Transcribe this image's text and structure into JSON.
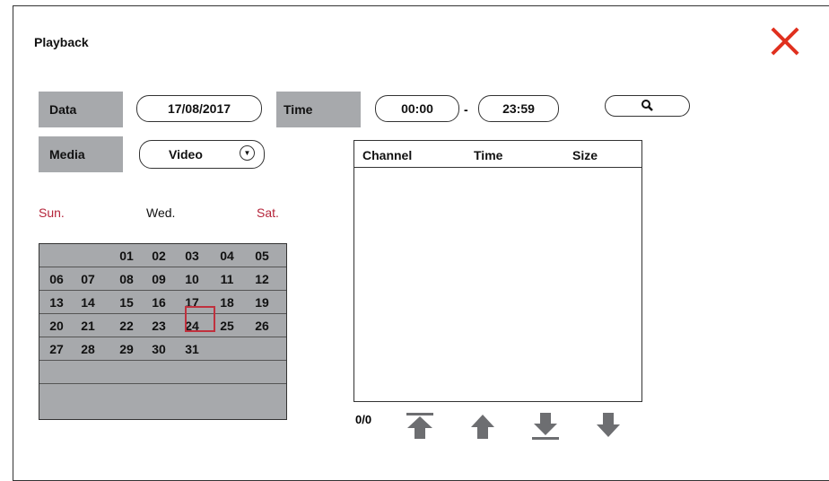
{
  "window": {
    "title": "Playback"
  },
  "filters": {
    "date_label": "Data",
    "date_value": "17/08/2017",
    "time_label": "Time",
    "time_start": "00:00",
    "time_separator": "-",
    "time_end": "23:59",
    "media_label": "Media",
    "media_value": "Video"
  },
  "calendar": {
    "day_headers": [
      "Sun.",
      "Wed.",
      "Sat."
    ],
    "selected_day": "17",
    "weeks": [
      [
        "",
        "",
        "01",
        "02",
        "03",
        "04",
        "05"
      ],
      [
        "06",
        "07",
        "08",
        "09",
        "10",
        "11",
        "12"
      ],
      [
        "13",
        "14",
        "15",
        "16",
        "17",
        "18",
        "19"
      ],
      [
        "20",
        "21",
        "22",
        "23",
        "24",
        "25",
        "26"
      ],
      [
        "27",
        "28",
        "29",
        "30",
        "31",
        "",
        ""
      ],
      [
        "",
        "",
        "",
        "",
        "",
        "",
        ""
      ]
    ]
  },
  "results": {
    "columns": [
      "Channel",
      "Time",
      "Size"
    ],
    "rows": [],
    "counter": "0/0"
  },
  "colors": {
    "accent_red": "#e0301e",
    "weekend_red": "#b5243a",
    "panel_gray": "#a7a9ac"
  },
  "icons": [
    "close-icon",
    "search-icon",
    "dropdown-arrow-icon",
    "first-page-icon",
    "previous-page-icon",
    "next-page-icon",
    "last-page-icon"
  ]
}
